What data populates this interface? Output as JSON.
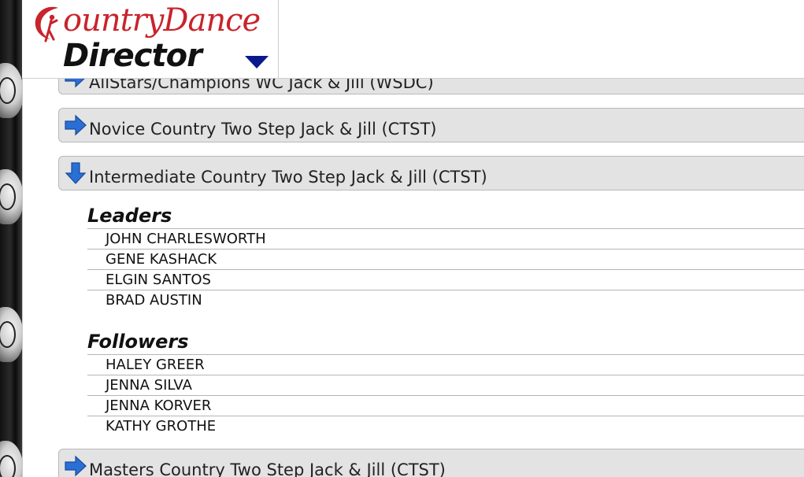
{
  "header": {
    "logo_top": "ountryDance",
    "logo_bottom": "Director"
  },
  "colors": {
    "accent_red": "#c8242c",
    "arrow_blue": "#2a6fd6",
    "menu_navy": "#0a1a8c",
    "header_bg": "#e3e3e3"
  },
  "accordion": {
    "sections": [
      {
        "label": "AllStars/Champions WC Jack & Jill (WSDC)",
        "state": "collapsed",
        "icon": "arrow-right-icon"
      },
      {
        "label": "Novice Country Two Step Jack & Jill (CTST)",
        "state": "collapsed",
        "icon": "arrow-right-icon"
      },
      {
        "label": "Intermediate Country Two Step Jack & Jill (CTST)",
        "state": "expanded",
        "icon": "arrow-down-icon"
      },
      {
        "label": "Masters Country Two Step Jack & Jill (CTST)",
        "state": "collapsed",
        "icon": "arrow-right-icon"
      }
    ]
  },
  "expanded": {
    "leaders_title": "Leaders",
    "leaders": [
      "JOHN CHARLESWORTH",
      "GENE KASHACK",
      "ELGIN SANTOS",
      "BRAD AUSTIN"
    ],
    "followers_title": "Followers",
    "followers": [
      "HALEY GREER",
      "JENNA SILVA",
      "JENNA KORVER",
      "KATHY GROTHE"
    ]
  }
}
